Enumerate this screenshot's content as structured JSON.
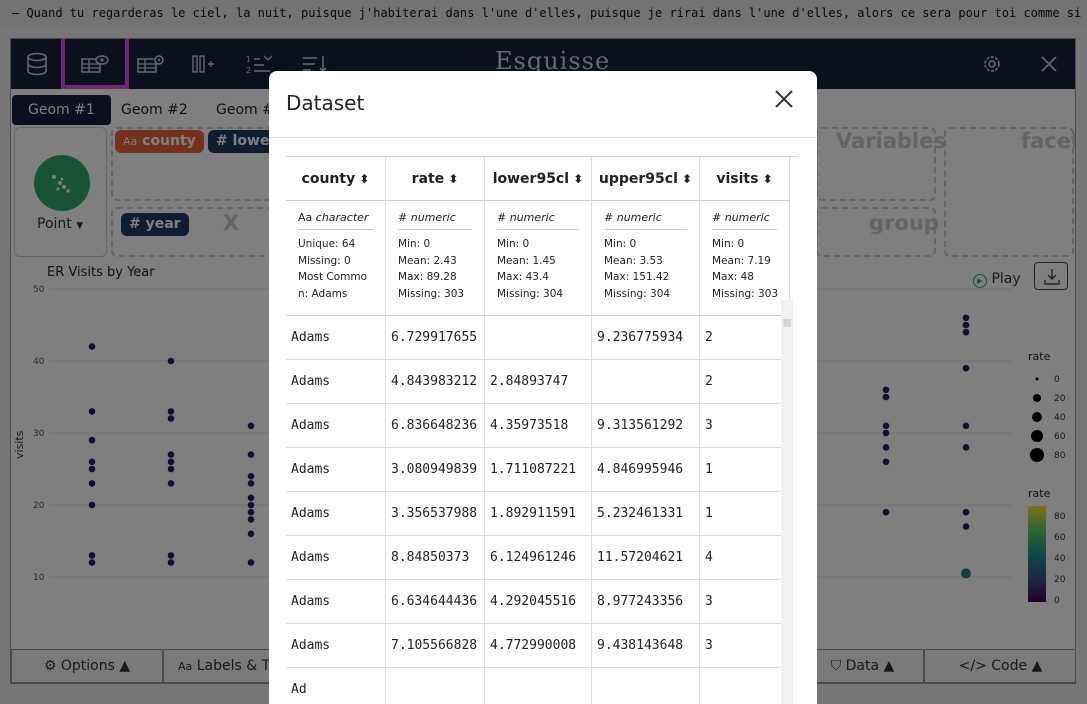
{
  "banner": "— Quand tu regarderas le ciel, la nuit, puisque j'habiterai dans l'une d'elles, puisque je rirai dans l'une d'elles, alors ce sera pour toi comme si riaient toutes les étoiles.",
  "app": {
    "brand": "Esquisse",
    "tabs": [
      "Geom #1",
      "Geom #2",
      "Geom #"
    ],
    "geom_label": "Point",
    "chips": {
      "county": "county",
      "lower": "lower",
      "year": "year"
    },
    "dropzones": {
      "variables": "Variables",
      "facet": "facet",
      "group": "group",
      "x": "X"
    },
    "plot_title": "ER Visits by Year",
    "play_label": "Play",
    "y_axis_label": "visits",
    "y_ticks": [
      "50",
      "40",
      "30",
      "20",
      "10"
    ],
    "legend_size": {
      "title": "rate",
      "labels": [
        "0",
        "20",
        "40",
        "60",
        "80"
      ]
    },
    "legend_color": {
      "title": "rate",
      "labels": [
        "80",
        "60",
        "40",
        "20",
        "0"
      ]
    },
    "bottom": {
      "options": "Options",
      "labels": "Labels & T",
      "data": "Data",
      "code": "Code"
    },
    "colors": {
      "nav": "#14213d",
      "highlight": "#e94ce6",
      "chip_orange": "#e8623a",
      "chip_navy": "#1e3a66",
      "geom_green": "#2ea86d"
    }
  },
  "modal": {
    "title": "Dataset",
    "columns": [
      {
        "name": "county",
        "type": "character",
        "stats": [
          "Unique: 64",
          "Missing: 0",
          "Most Commo",
          "n: Adams"
        ]
      },
      {
        "name": "rate",
        "type": "numeric",
        "stats": [
          "Min: 0",
          "Mean: 2.43",
          "Max: 89.28",
          "Missing: 303"
        ]
      },
      {
        "name": "lower95cl",
        "type": "numeric",
        "stats": [
          "Min: 0",
          "Mean: 1.45",
          "Max: 43.4",
          "Missing: 304"
        ]
      },
      {
        "name": "upper95cl",
        "type": "numeric",
        "stats": [
          "Min: 0",
          "Mean: 3.53",
          "Max: 151.42",
          "Missing: 304"
        ]
      },
      {
        "name": "visits",
        "type": "numeric",
        "stats": [
          "Min: 0",
          "Mean: 7.19",
          "Max: 48",
          "Missing: 303"
        ]
      }
    ],
    "rows": [
      [
        "Adams",
        "6.729917655",
        "",
        "9.236775934",
        "2"
      ],
      [
        "Adams",
        "4.843983212",
        "2.84893747",
        "",
        "2"
      ],
      [
        "Adams",
        "6.836648236",
        "4.35973518",
        "9.313561292",
        "3"
      ],
      [
        "Adams",
        "3.080949839",
        "1.711087221",
        "4.846995946",
        "1"
      ],
      [
        "Adams",
        "3.356537988",
        "1.892911591",
        "5.232461331",
        "1"
      ],
      [
        "Adams",
        "8.84850373",
        "6.124961246",
        "11.57204621",
        "4"
      ],
      [
        "Adams",
        "6.634644436",
        "4.292045516",
        "8.977243356",
        "3"
      ],
      [
        "Adams",
        "7.105566828",
        "4.772990008",
        "9.438143648",
        "3"
      ],
      [
        "Ad",
        "",
        "",
        "",
        ""
      ]
    ]
  }
}
